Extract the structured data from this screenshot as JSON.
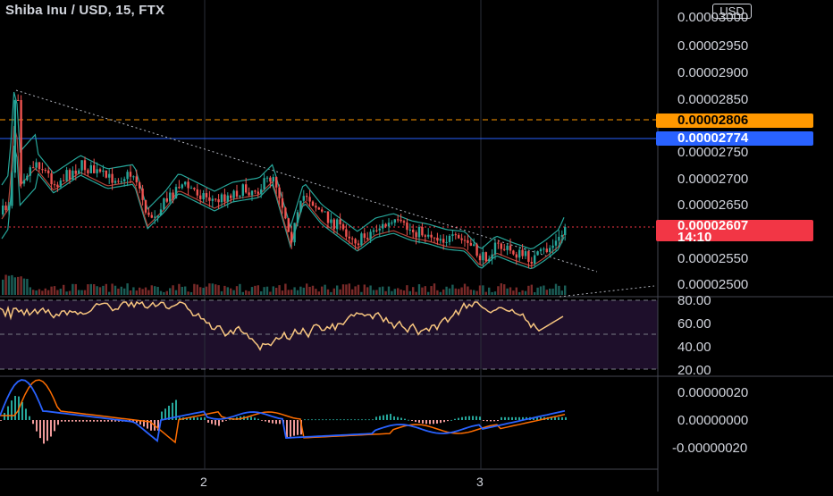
{
  "header": {
    "symbol": "Shiba Inu / USD, 15, FTX"
  },
  "currency_button": "USD",
  "price_axis": {
    "labels": [
      "0.00003000",
      "0.00002950",
      "0.00002900",
      "0.00002850",
      "0.00002750",
      "0.00002700",
      "0.00002650",
      "0.00002550",
      "0.00002500"
    ]
  },
  "price_tags": {
    "orange": "0.00002806",
    "blue": "0.00002774",
    "current": "0.00002607",
    "countdown": "14:10"
  },
  "rsi_axis": {
    "labels": [
      "80.00",
      "60.00",
      "40.00",
      "20.00"
    ]
  },
  "macd_axis": {
    "labels": [
      "0.00000020",
      "0.00000000",
      "-0.00000020"
    ]
  },
  "time_axis": {
    "labels": [
      "2",
      "3"
    ]
  },
  "colors": {
    "up": "#26a69a",
    "down": "#ef5350",
    "orange": "#ff9800",
    "blue": "#2962ff",
    "rsi": "#f7c57f",
    "macd": "#2962ff",
    "signal": "#ff6d00"
  }
}
